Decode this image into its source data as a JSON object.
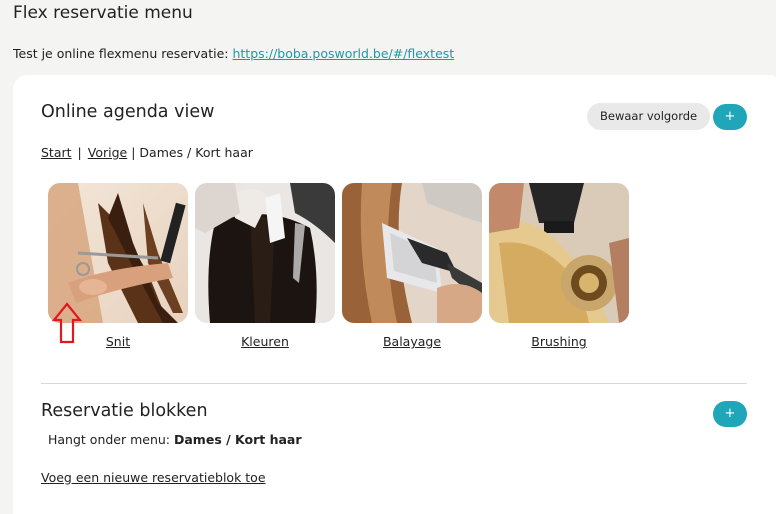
{
  "page": {
    "title": "Flex reservatie menu",
    "test_text": "Test je online flexmenu reservatie: ",
    "test_link": "https://boba.posworld.be/#/flextest"
  },
  "agenda": {
    "title": "Online agenda view",
    "save_order_label": "Bewaar volgorde",
    "add_label": "+",
    "breadcrumb": {
      "start": "Start",
      "sep1": "|",
      "previous": "Vorige",
      "sep2": "|",
      "current": "Dames / Kort haar"
    },
    "tiles": [
      {
        "label": "Snit"
      },
      {
        "label": "Kleuren"
      },
      {
        "label": "Balayage"
      },
      {
        "label": "Brushing"
      }
    ]
  },
  "blocks": {
    "title": "Reservatie blokken",
    "add_label": "+",
    "parent_text": "Hangt onder menu: ",
    "parent_value": "Dames / Kort haar",
    "add_link": "Voeg een nieuwe reservatieblok toe"
  },
  "colors": {
    "accent": "#1fa6b8",
    "link": "#1a9aa8",
    "annotation_arrow": "#e0191f"
  }
}
